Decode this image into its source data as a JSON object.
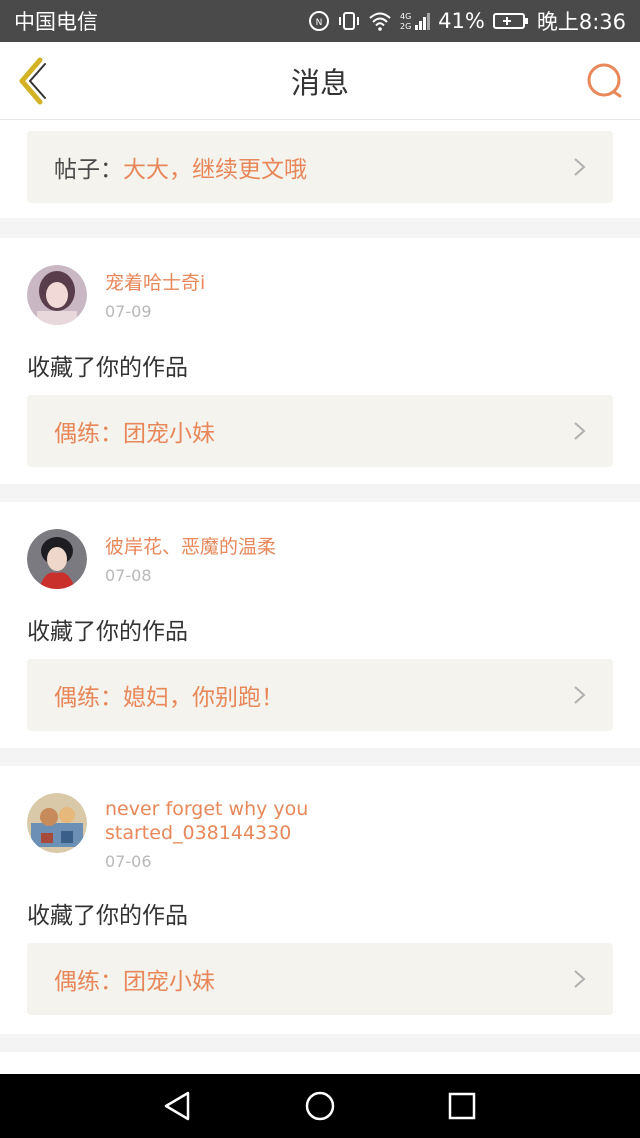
{
  "status_bar": {
    "carrier": "中国电信",
    "network": "4G",
    "battery": "41%",
    "time": "晚上8:36"
  },
  "header": {
    "title": "消息",
    "back_icon": "chevron-left-icon",
    "search_icon": "search-icon"
  },
  "top_card": {
    "prefix": "帖子：",
    "text": "大大，继续更文哦"
  },
  "messages": [
    {
      "username": "宠着哈士奇i",
      "date": "07-09",
      "action": "收藏了你的作品",
      "link_prefix": "偶练：",
      "link_text": "团宠小妹"
    },
    {
      "username": "彼岸花、恶魔的温柔",
      "date": "07-08",
      "action": "收藏了你的作品",
      "link_prefix": "偶练：",
      "link_text": "媳妇，你别跑！"
    },
    {
      "username_line1": "never forget why you",
      "username_line2": "started_038144330",
      "date": "07-06",
      "action": "收藏了你的作品",
      "link_prefix": "偶练：",
      "link_text": "团宠小妹"
    }
  ],
  "colors": {
    "accent": "#e8885a",
    "header_back": "#d4b226",
    "box_bg": "#f4f3ed"
  }
}
